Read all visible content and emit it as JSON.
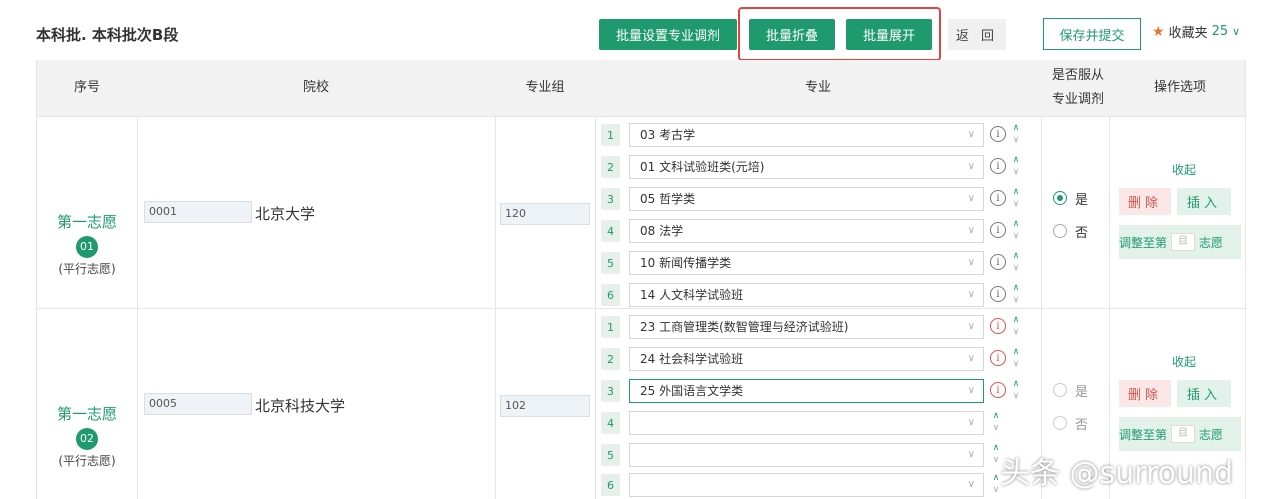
{
  "header": {
    "title": "本科批. 本科批次B段",
    "batch_setting_label": "批量设置专业调剂",
    "batch_collapse_label": "批量折叠",
    "batch_expand_label": "批量展开",
    "back_label": "返 回",
    "save_submit_label": "保存并提交",
    "favorites_label": "收藏夹",
    "favorites_count": "25"
  },
  "table": {
    "headers": {
      "index": "序号",
      "school": "院校",
      "major_group": "专业组",
      "major": "专业",
      "obey_line1": "是否服从",
      "obey_line2": "专业调剂",
      "ops": "操作选项"
    },
    "rows": [
      {
        "wish_title": "第一志愿",
        "wish_number": "01",
        "wish_type": "(平行志愿)",
        "school_code": "0001",
        "school_name": "北京大学",
        "group_code": "120",
        "majors": [
          {
            "num": "1",
            "text": "03  考古学"
          },
          {
            "num": "2",
            "text": "01  文科试验班类(元培)"
          },
          {
            "num": "3",
            "text": "05  哲学类"
          },
          {
            "num": "4",
            "text": "08  法学"
          },
          {
            "num": "5",
            "text": "10  新闻传播学类"
          },
          {
            "num": "6",
            "text": "14  人文科学试验班"
          }
        ],
        "obey_yes": "是",
        "obey_no": "否",
        "collapse_label": "收起",
        "delete_label": "删除",
        "insert_label": "插入",
        "adjust_prefix": "调整至第",
        "adjust_placeholder": "目",
        "adjust_suffix": "志愿"
      },
      {
        "wish_title": "第一志愿",
        "wish_number": "02",
        "wish_type": "(平行志愿)",
        "school_code": "0005",
        "school_name": "北京科技大学",
        "group_code": "102",
        "majors": [
          {
            "num": "1",
            "text": "23  工商管理类(数智管理与经济试验班)"
          },
          {
            "num": "2",
            "text": "24  社会科学试验班"
          },
          {
            "num": "3",
            "text": "25  外国语言文学类"
          },
          {
            "num": "4",
            "text": ""
          },
          {
            "num": "5",
            "text": ""
          },
          {
            "num": "6",
            "text": ""
          }
        ],
        "obey_yes": "是",
        "obey_no": "否",
        "collapse_label": "收起",
        "delete_label": "删除",
        "insert_label": "插入",
        "adjust_prefix": "调整至第",
        "adjust_placeholder": "目",
        "adjust_suffix": "志愿"
      }
    ]
  },
  "watermark": "头条 @surround",
  "colors": {
    "accent": "#1f9a6e",
    "danger": "#d9534f",
    "highlight": "#e0443e"
  }
}
